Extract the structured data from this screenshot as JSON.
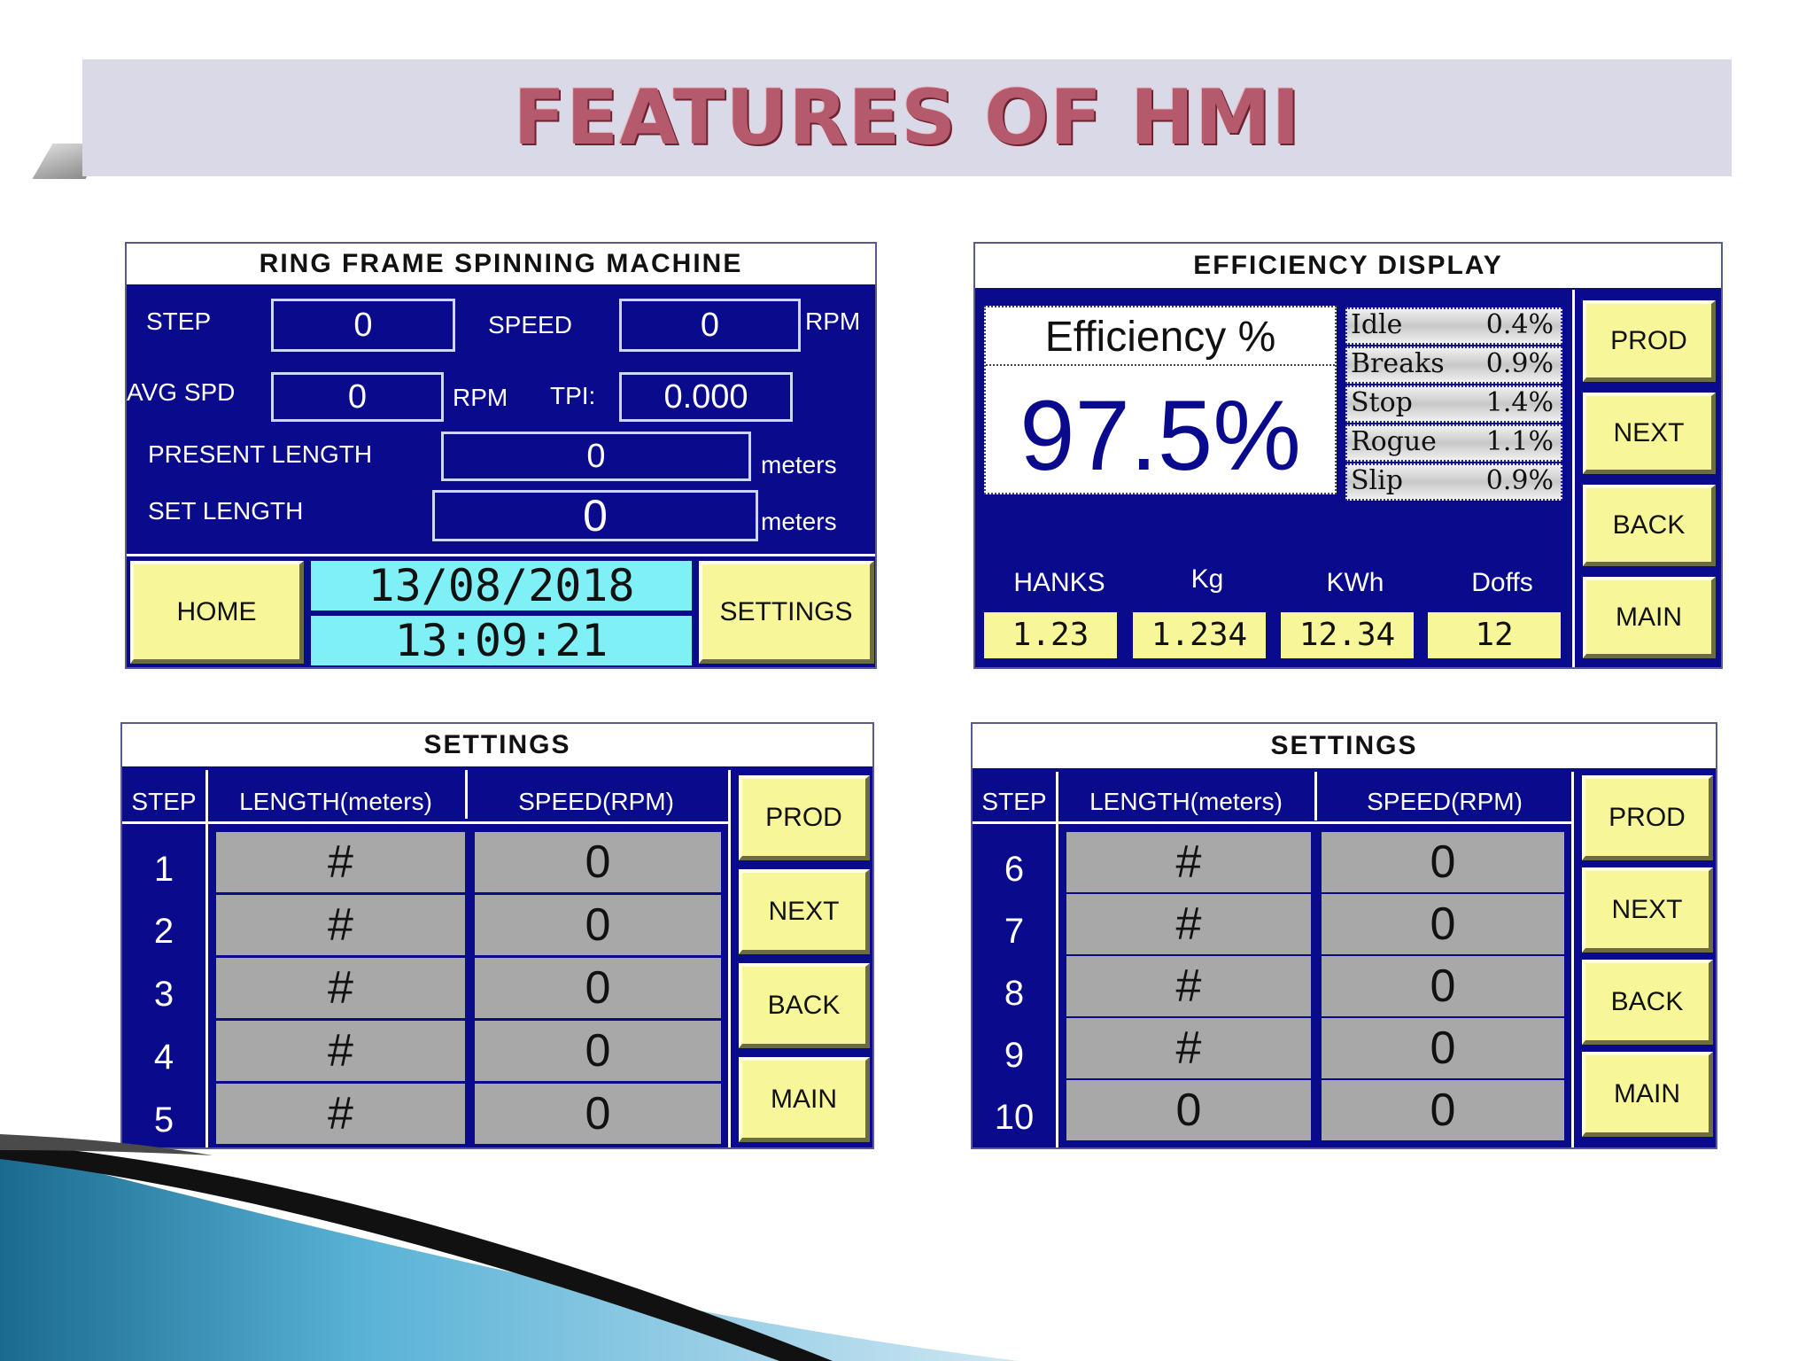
{
  "slide_title": "FEATURES OF HMI",
  "ring_frame": {
    "header": "RING FRAME SPINNING MACHINE",
    "step_label": "STEP",
    "step_value": "0",
    "speed_label": "SPEED",
    "speed_value": "0",
    "speed_unit": "RPM",
    "avg_spd_label": "AVG SPD",
    "avg_spd_value": "0",
    "avg_spd_unit": "RPM",
    "tpi_label": "TPI:",
    "tpi_value": "0.000",
    "present_length_label": "PRESENT LENGTH",
    "present_length_value": "0",
    "present_length_unit": "meters",
    "set_length_label": "SET LENGTH",
    "set_length_value": "0",
    "set_length_unit": "meters",
    "home_button": "HOME",
    "date": "13/08/2018",
    "time": "13:09:21",
    "settings_button": "SETTINGS"
  },
  "efficiency": {
    "header": "EFFICIENCY DISPLAY",
    "efficiency_label": "Efficiency %",
    "efficiency_value": "97.5%",
    "losses": [
      {
        "name": "Idle",
        "value": "0.4%"
      },
      {
        "name": "Breaks",
        "value": "0.9%"
      },
      {
        "name": "Stop",
        "value": "1.4%"
      },
      {
        "name": "Rogue",
        "value": "1.1%"
      },
      {
        "name": "Slip",
        "value": "0.9%"
      }
    ],
    "stats": [
      {
        "label": "HANKS",
        "value": "1.23"
      },
      {
        "label": "Kg",
        "value": "1.234"
      },
      {
        "label": "KWh",
        "value": "12.34"
      },
      {
        "label": "Doffs",
        "value": "12"
      }
    ],
    "buttons": {
      "prod": "PROD",
      "next": "NEXT",
      "back": "BACK",
      "main": "MAIN"
    }
  },
  "settings_1": {
    "header": "SETTINGS",
    "col_step": "STEP",
    "col_length": "LENGTH(meters)",
    "col_speed": "SPEED(RPM)",
    "rows": [
      {
        "step": "1",
        "length": "#",
        "speed": "0"
      },
      {
        "step": "2",
        "length": "#",
        "speed": "0"
      },
      {
        "step": "3",
        "length": "#",
        "speed": "0"
      },
      {
        "step": "4",
        "length": "#",
        "speed": "0"
      },
      {
        "step": "5",
        "length": "#",
        "speed": "0"
      }
    ],
    "buttons": {
      "prod": "PROD",
      "next": "NEXT",
      "back": "BACK",
      "main": "MAIN"
    }
  },
  "settings_2": {
    "header": "SETTINGS",
    "col_step": "STEP",
    "col_length": "LENGTH(meters)",
    "col_speed": "SPEED(RPM)",
    "rows": [
      {
        "step": "6",
        "length": "#",
        "speed": "0"
      },
      {
        "step": "7",
        "length": "#",
        "speed": "0"
      },
      {
        "step": "8",
        "length": "#",
        "speed": "0"
      },
      {
        "step": "9",
        "length": "#",
        "speed": "0"
      },
      {
        "step": "10",
        "length": "0",
        "speed": "0"
      }
    ],
    "buttons": {
      "prod": "PROD",
      "next": "NEXT",
      "back": "BACK",
      "main": "MAIN"
    }
  }
}
